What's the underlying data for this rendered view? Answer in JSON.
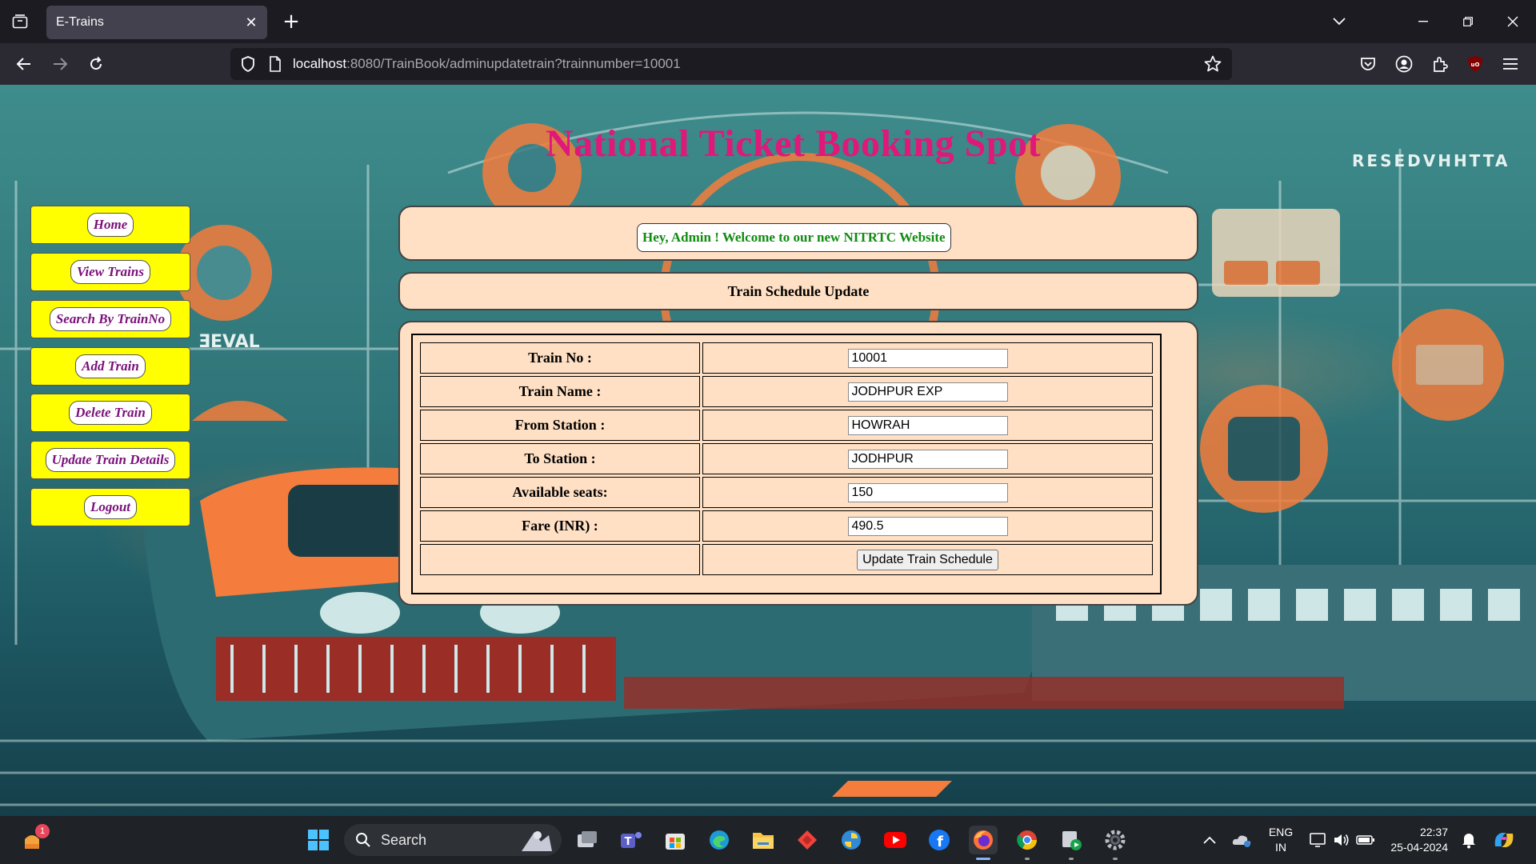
{
  "browser": {
    "tab_title": "E-Trains",
    "url_host": "localhost",
    "url_rest": ":8080/TrainBook/adminupdatetrain?trainnumber=10001"
  },
  "page": {
    "site_title": "National Ticket Booking Spot",
    "welcome_message": "Hey, Admin ! Welcome to our new NITRTC Website",
    "section_title": "Train Schedule Update",
    "sidebar": [
      {
        "label": "Home"
      },
      {
        "label": "View Trains"
      },
      {
        "label": "Search By TrainNo"
      },
      {
        "label": "Add Train"
      },
      {
        "label": "Delete Train"
      },
      {
        "label": "Update Train Details"
      },
      {
        "label": "Logout"
      }
    ],
    "form": {
      "fields": [
        {
          "label": "Train No :",
          "value": "10001"
        },
        {
          "label": "Train Name :",
          "value": "JODHPUR EXP"
        },
        {
          "label": "From Station :",
          "value": "HOWRAH"
        },
        {
          "label": "To Station :",
          "value": "JODHPUR"
        },
        {
          "label": "Available seats:",
          "value": "150"
        },
        {
          "label": "Fare (INR) :",
          "value": "490.5"
        }
      ],
      "submit_label": "Update Train Schedule"
    },
    "background_art_text": {
      "left_sign": "ƎEVAL",
      "right_sign": "RESEDVHHTTA"
    }
  },
  "taskbar": {
    "search_label": "Search",
    "notification_count": "1",
    "language_line1": "ENG",
    "language_line2": "IN",
    "time": "22:37",
    "date": "25-04-2024"
  },
  "colors": {
    "title": "#e0187a",
    "sidebar_bg": "#ffff00",
    "sidebar_text": "#7a0f7a",
    "panel_bg": "#ffe0c4",
    "welcome_text": "#108c10"
  }
}
